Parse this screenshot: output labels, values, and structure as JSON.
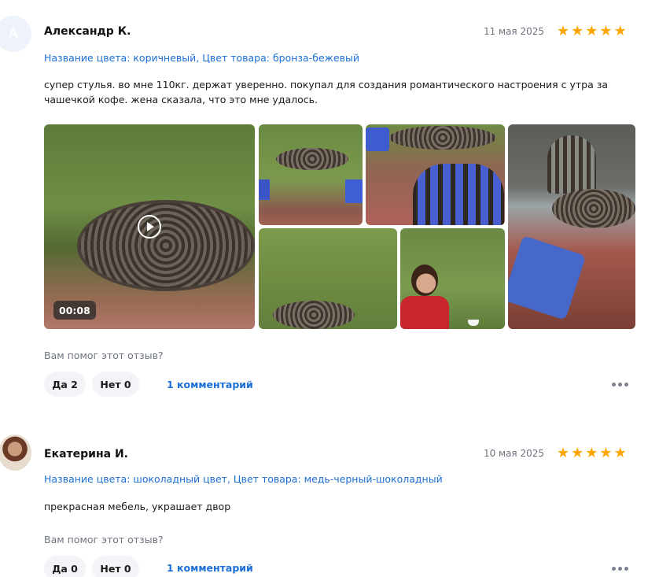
{
  "reviews": [
    {
      "avatar_letter": "А",
      "author": "Александр К.",
      "date": "11 мая 2025",
      "rating": 5,
      "variant": "Название цвета: коричневый, Цвет товара: бронза-бежевый",
      "text": "супер стулья. во мне 110кг. держат уверенно. покупал для создания романтического настроения с утра за чашечкой кофе. жена сказала, что это мне удалось.",
      "video_duration": "00:08",
      "helpful_question": "Вам помог этот отзыв?",
      "yes_label": "Да 2",
      "no_label": "Нет 0",
      "comments_label": "1 комментарий"
    },
    {
      "author": "Екатерина И.",
      "date": "10 мая 2025",
      "rating": 5,
      "variant": "Название цвета: шоколадный цвет, Цвет товара: медь-черный-шоколадный",
      "text": "прекрасная мебель, украшает двор",
      "helpful_question": "Вам помог этот отзыв?",
      "yes_label": "Да 0",
      "no_label": "Нет 0",
      "comments_label": "1 комментарий"
    }
  ],
  "icons": {
    "star": "star-icon",
    "play": "play-icon",
    "more": "more-icon"
  },
  "colors": {
    "star": "#ffa500",
    "link": "#1b6fd6",
    "muted": "#6e7480",
    "button_bg": "#f2f4f7"
  }
}
